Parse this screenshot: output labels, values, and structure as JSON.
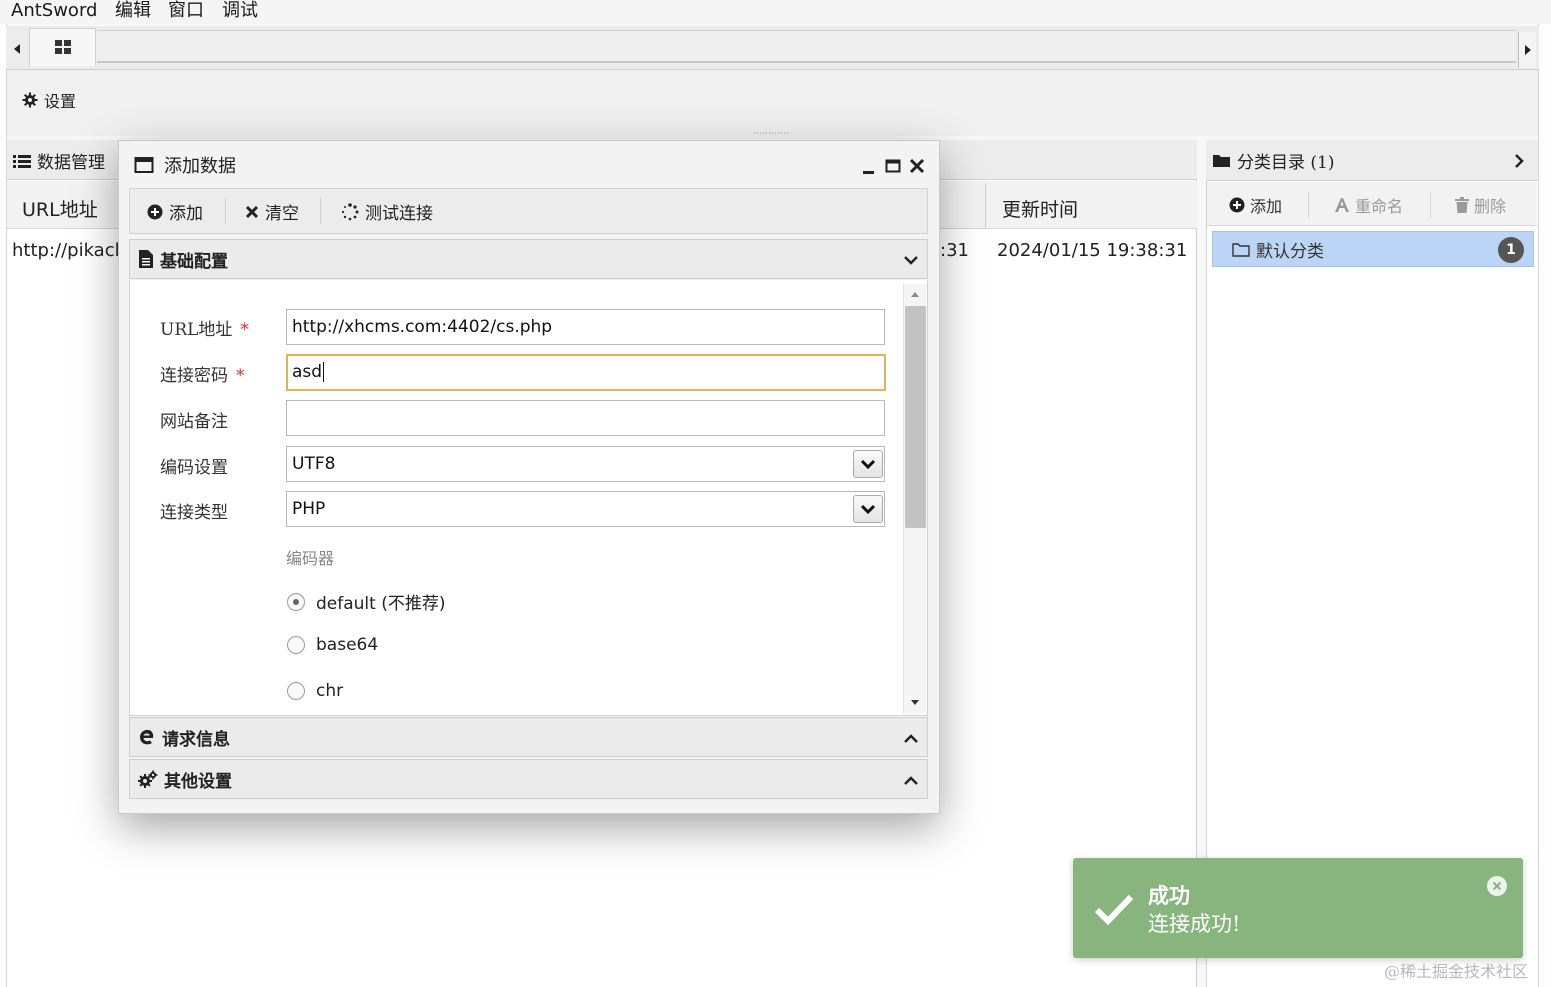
{
  "menubar": {
    "app": "AntSword",
    "edit": "编辑",
    "window": "窗口",
    "debug": "调试"
  },
  "toolbar": {
    "settings": "设置"
  },
  "left_panel": {
    "title": "数据管理",
    "columns": {
      "url": "URL地址",
      "updated": "更新时间"
    },
    "rows": [
      {
        "url": "http://pikacl",
        "created": ":31",
        "updated": "2024/01/15 19:38:31"
      }
    ]
  },
  "right_panel": {
    "title": "分类目录 (1)",
    "toolbar": {
      "add": "添加",
      "rename": "重命名",
      "delete": "删除"
    },
    "categories": [
      {
        "name": "默认分类",
        "count": "1"
      }
    ]
  },
  "dialog": {
    "title": "添加数据",
    "toolbar": {
      "add": "添加",
      "clear": "清空",
      "test": "测试连接"
    },
    "sections": {
      "basic": "基础配置",
      "request": "请求信息",
      "other": "其他设置"
    },
    "form": {
      "url_label": "URL地址",
      "url_value": "http://xhcms.com:4402/cs.php",
      "password_label": "连接密码",
      "password_value": "asd",
      "note_label": "网站备注",
      "note_value": "",
      "encoding_label": "编码设置",
      "encoding_value": "UTF8",
      "type_label": "连接类型",
      "type_value": "PHP",
      "required_mark": "*",
      "encoder_label": "编码器",
      "encoders": [
        {
          "label": "default (不推荐)",
          "selected": true
        },
        {
          "label": "base64",
          "selected": false
        },
        {
          "label": "chr",
          "selected": false
        }
      ]
    }
  },
  "toast": {
    "title": "成功",
    "message": "连接成功!"
  },
  "watermark": "@稀土掘金技术社区",
  "colors": {
    "toast_bg": "#88b57d",
    "selected_row": "#bcd4f5",
    "focus_border": "#e0b458",
    "required": "#dd3333"
  }
}
